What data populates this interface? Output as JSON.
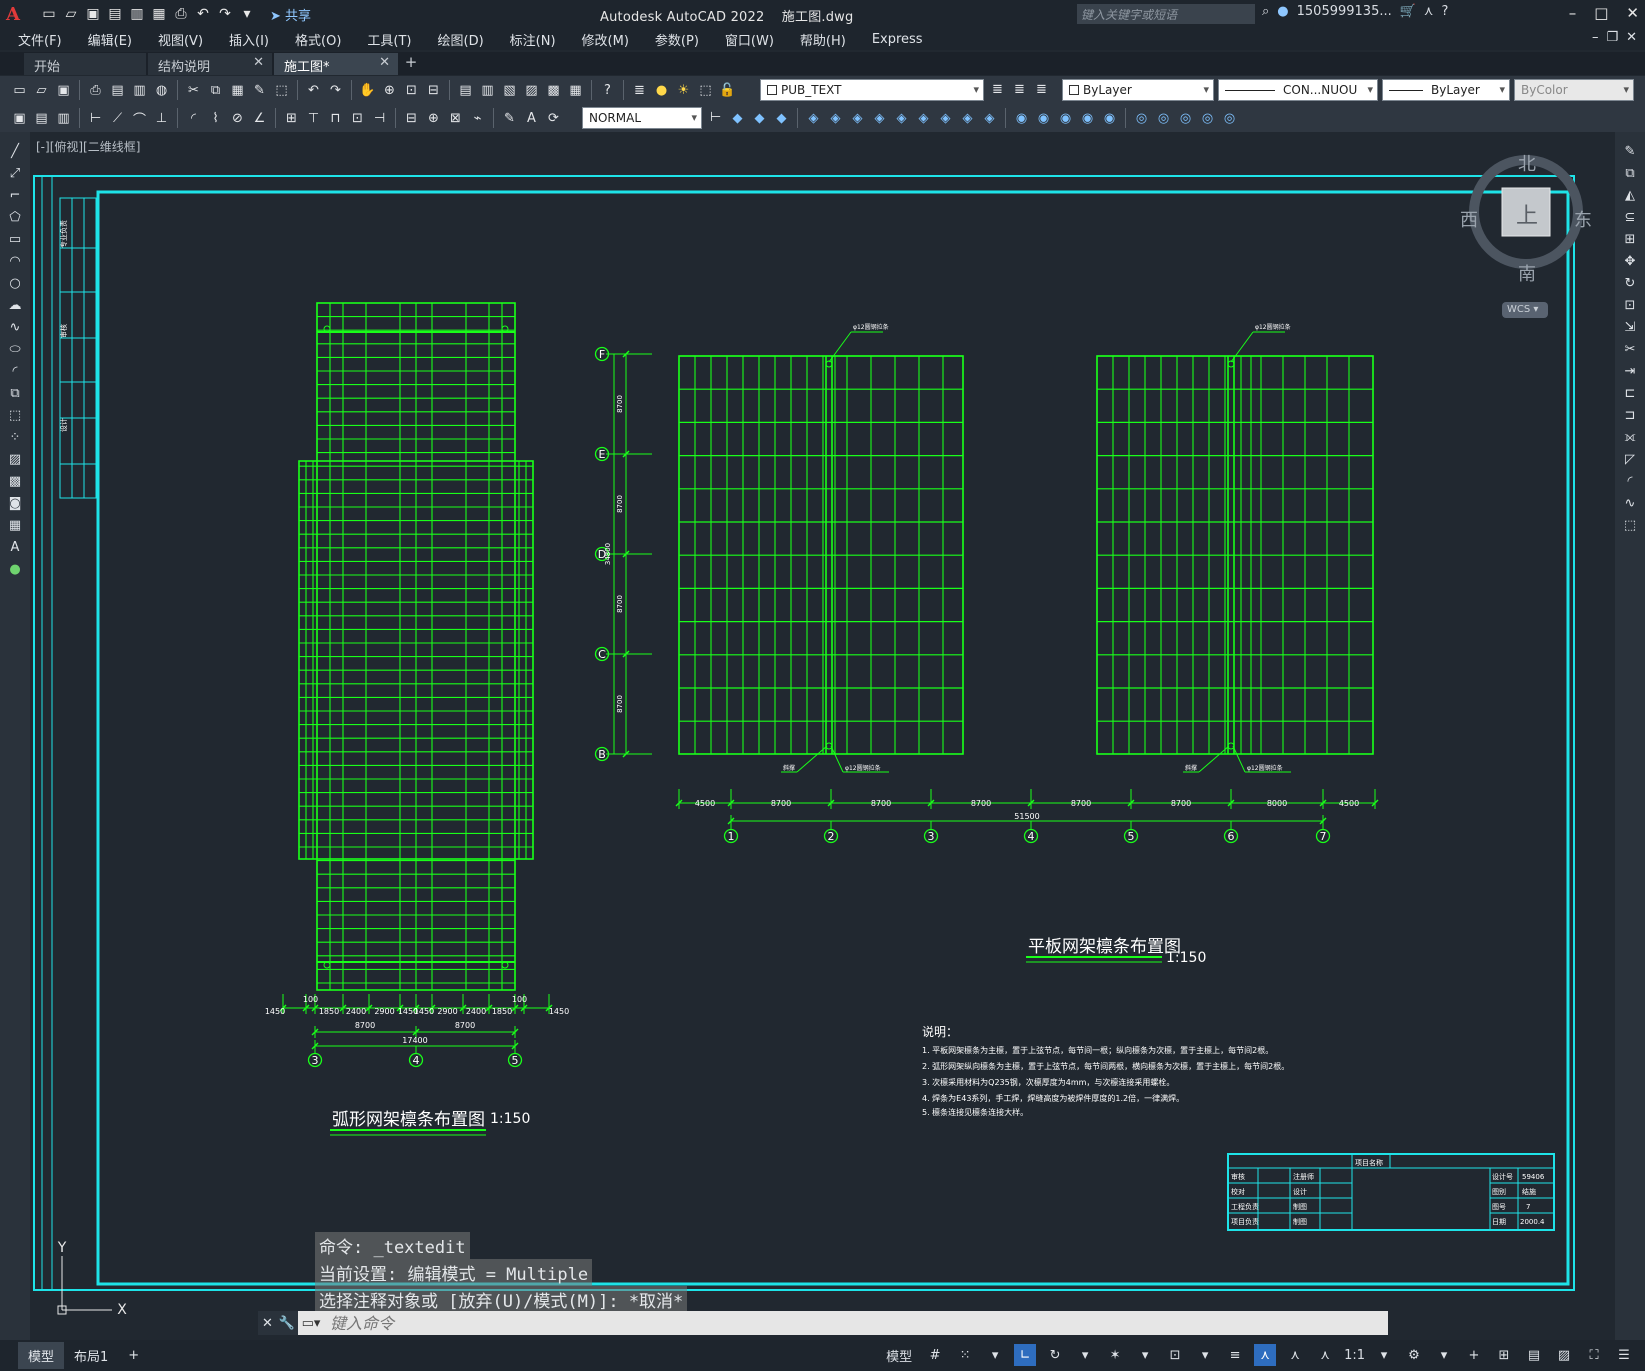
{
  "app": {
    "title": "Autodesk AutoCAD 2022",
    "filename": "施工图.dwg",
    "share_label": "共享",
    "search_placeholder": "键入关键字或短语",
    "user": "1505999135..."
  },
  "menu": [
    "文件(F)",
    "编辑(E)",
    "视图(V)",
    "插入(I)",
    "格式(O)",
    "工具(T)",
    "绘图(D)",
    "标注(N)",
    "修改(M)",
    "参数(P)",
    "窗口(W)",
    "帮助(H)",
    "Express"
  ],
  "tabs": [
    {
      "label": "开始"
    },
    {
      "label": "结构说明"
    },
    {
      "label": "施工图*"
    }
  ],
  "toolbar": {
    "layer": "PUB_TEXT",
    "color": "ByLayer",
    "linetype": "CON...NUOU",
    "lineweight": "ByLayer",
    "plotstyle": "ByColor",
    "dimstyle": "NORMAL"
  },
  "viewport_label": "[-][俯视][二维线框]",
  "viewcube": {
    "north": "北",
    "south": "南",
    "east": "东",
    "west": "西",
    "top": "上",
    "wcs": "WCS"
  },
  "ucs": {
    "x": "X",
    "y": "Y"
  },
  "drawing": {
    "plan1": {
      "title": "弧形网架檩条布置图",
      "scale": "1:150",
      "bottom_dims": [
        "1450",
        "100",
        "1850",
        "2400",
        "2900",
        "1450",
        "1450",
        "2900",
        "2400",
        "1850",
        "100",
        "1450"
      ],
      "mid_dims": [
        "8700",
        "8700"
      ],
      "total": "17400",
      "axes": [
        "3",
        "4",
        "5"
      ]
    },
    "plan2": {
      "title": "平板网架檩条布置图",
      "scale": "1:150",
      "row_axes": [
        "F",
        "E",
        "D",
        "C",
        "B"
      ],
      "row_dims": [
        "8700",
        "8700",
        "8700",
        "8700"
      ],
      "row_total": "34800",
      "col_dims": [
        "4500",
        "8700",
        "8700",
        "8700",
        "8700",
        "8700",
        "8000",
        "4500"
      ],
      "col_total": "51500",
      "col_axes": [
        "1",
        "2",
        "3",
        "4",
        "5",
        "6",
        "7"
      ],
      "callout_top": "φ12圆钢拉条",
      "callout_bottom_left": "斜撑",
      "callout_bottom_right": "φ12圆钢拉条"
    },
    "notes": {
      "heading": "说明：",
      "items": [
        "1. 平板网架檩条为主檩，置于上弦节点，每节间一根；纵向檩条为次檩，置于主檩上，每节间2根。",
        "2. 弧形网架纵向檩条为主檩，置于上弦节点，每节间两根，横向檩条为次檩，置于主檩上，每节间2根。",
        "3. 次檩采用材料为Q235钢，次檩厚度为4mm，与次檩连接采用螺栓。",
        "4. 焊条为E43系列，手工焊，焊缝高度为被焊件厚度的1.2倍，一律满焊。",
        "5. 檩条连接见檩条连接大样。"
      ]
    },
    "titleblock": {
      "project_label": "项目名称",
      "rows_left": [
        "审核",
        "校对",
        "工程负责",
        "项目负责"
      ],
      "rows_mid": [
        "注册师",
        "设计",
        "制图",
        "制图"
      ],
      "rows_right_label": [
        "设计号",
        "图别",
        "图号",
        "日期"
      ],
      "rows_right_value": [
        "59406",
        "结施",
        "7",
        "2000.4"
      ]
    },
    "frame_strip_labels": [
      "专业负责",
      "审核",
      "设计"
    ]
  },
  "command": {
    "history": [
      "命令: _textedit",
      "当前设置: 编辑模式 = Multiple",
      "选择注释对象或 [放弃(U)/模式(M)]: *取消*"
    ],
    "placeholder": "键入命令"
  },
  "status": {
    "tabs": [
      "模型",
      "布局1"
    ],
    "model_btn": "模型",
    "scale": "1:1"
  },
  "colors": {
    "background": "#212830",
    "frame": "#1ee3e8",
    "geometry": "#19ff19",
    "text": "#ffffff"
  }
}
